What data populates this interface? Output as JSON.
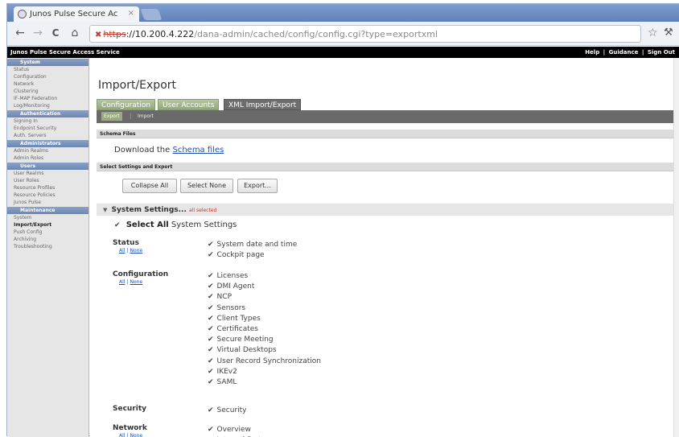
{
  "browser": {
    "tab_title": "Junos Pulse Secure Ac",
    "tab_close": "×",
    "url_scheme": "https",
    "url_host": "://10.200.4.222",
    "url_path": "/dana-admin/cached/config/config.cgi?type=exportxml",
    "back_glyph": "←",
    "forward_glyph": "→",
    "reload_glyph": "C",
    "home_glyph": "⌂",
    "star_glyph": "☆",
    "wrench_glyph": "🔧"
  },
  "appbar": {
    "brand": "Junos Pulse Secure Access Service",
    "help": "Help",
    "guidance": "Guidance",
    "signout": "Sign Out",
    "sep": "|"
  },
  "sidebar": {
    "sections": [
      {
        "head": "System",
        "items": [
          "Status",
          "Configuration",
          "Network",
          "Clustering",
          "IF-MAP Federation",
          "Log/Monitoring"
        ]
      },
      {
        "head": "Authentication",
        "items": [
          "Signing In",
          "Endpoint Security",
          "Auth. Servers"
        ]
      },
      {
        "head": "Administrators",
        "items": [
          "Admin Realms",
          "Admin Roles"
        ]
      },
      {
        "head": "Users",
        "items": [
          "User Realms",
          "User Roles",
          "Resource Profiles",
          "Resource Policies",
          "Junos Pulse"
        ]
      },
      {
        "head": "Maintenance",
        "items": [
          "System",
          "Import/Export",
          "Push Config",
          "Archiving",
          "Troubleshooting"
        ]
      }
    ],
    "active_item": "Import/Export"
  },
  "main": {
    "title": "Import/Export",
    "tabs": [
      "Configuration",
      "User Accounts",
      "XML Import/Export"
    ],
    "subtabs": [
      "Export",
      "Import"
    ],
    "schema_header": "Schema Files",
    "download_text": "Download the",
    "schema_link": "Schema files",
    "select_header": "Select Settings and Export",
    "buttons": [
      "Collapse All",
      "Select None",
      "Export..."
    ],
    "system_settings": "System Settings...",
    "all_selected": "all selected",
    "select_all_bold": "Select All",
    "select_all_rest": "System Settings",
    "link_all": "All",
    "link_none": "None",
    "link_sep": "|",
    "check_glyph": "✔",
    "groups": [
      {
        "label": "Status",
        "links": true,
        "options": [
          "System date and time",
          "Cockpit page"
        ]
      },
      {
        "label": "Configuration",
        "links": true,
        "options": [
          "Licenses",
          "DMI Agent",
          "NCP",
          "Sensors",
          "Client Types",
          "Certificates",
          "Secure Meeting",
          "Virtual Desktops",
          "User Record Synchronization",
          "IKEv2",
          "SAML"
        ]
      },
      {
        "label": "Security",
        "links": false,
        "options": [
          "Security"
        ]
      },
      {
        "label": "Network",
        "links": true,
        "options": [
          "Overview",
          "Internal Port"
        ]
      }
    ]
  },
  "colors": {
    "tab_green": "#98ac7f",
    "sidebar_head": "#7a93bd",
    "link": "#1a50b5",
    "all_selected_red": "#c0392b"
  }
}
